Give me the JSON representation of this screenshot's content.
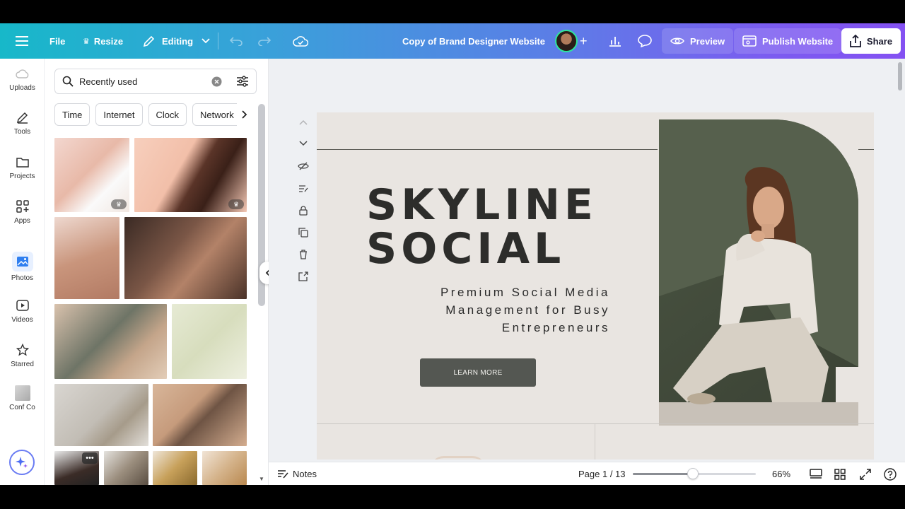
{
  "topbar": {
    "file_label": "File",
    "resize_label": "Resize",
    "editing_label": "Editing",
    "doc_title": "Copy of Brand Designer Website",
    "preview_label": "Preview",
    "publish_label": "Publish Website",
    "share_label": "Share"
  },
  "rail": {
    "items": [
      {
        "label": "Uploads",
        "icon": "cloud-upload-icon"
      },
      {
        "label": "Tools",
        "icon": "pen-tool-icon"
      },
      {
        "label": "Projects",
        "icon": "folder-icon"
      },
      {
        "label": "Apps",
        "icon": "apps-grid-icon"
      },
      {
        "label": "Photos",
        "icon": "image-icon"
      },
      {
        "label": "Videos",
        "icon": "play-icon"
      },
      {
        "label": "Starred",
        "icon": "star-icon"
      },
      {
        "label": "Conf Co",
        "icon": "brand-thumbnail-icon"
      }
    ]
  },
  "panel": {
    "search_value": "Recently used",
    "chips": [
      "Time",
      "Internet",
      "Clock",
      "Network"
    ]
  },
  "design": {
    "title_line1": "SKYLINE",
    "title_line2": "SOCIAL",
    "subtitle": "Premium Social Media Management for Busy Entrepreneurs",
    "cta_label": "LEARN MORE"
  },
  "bottombar": {
    "notes_label": "Notes",
    "page_indicator": "Page 1 / 13",
    "zoom_label": "66%",
    "zoom_level": 0.49
  },
  "colors": {
    "accent": "#17b8c9",
    "brand_purple": "#8451f2",
    "cta_bg": "#545752",
    "page_bg": "#e9e5e1"
  }
}
